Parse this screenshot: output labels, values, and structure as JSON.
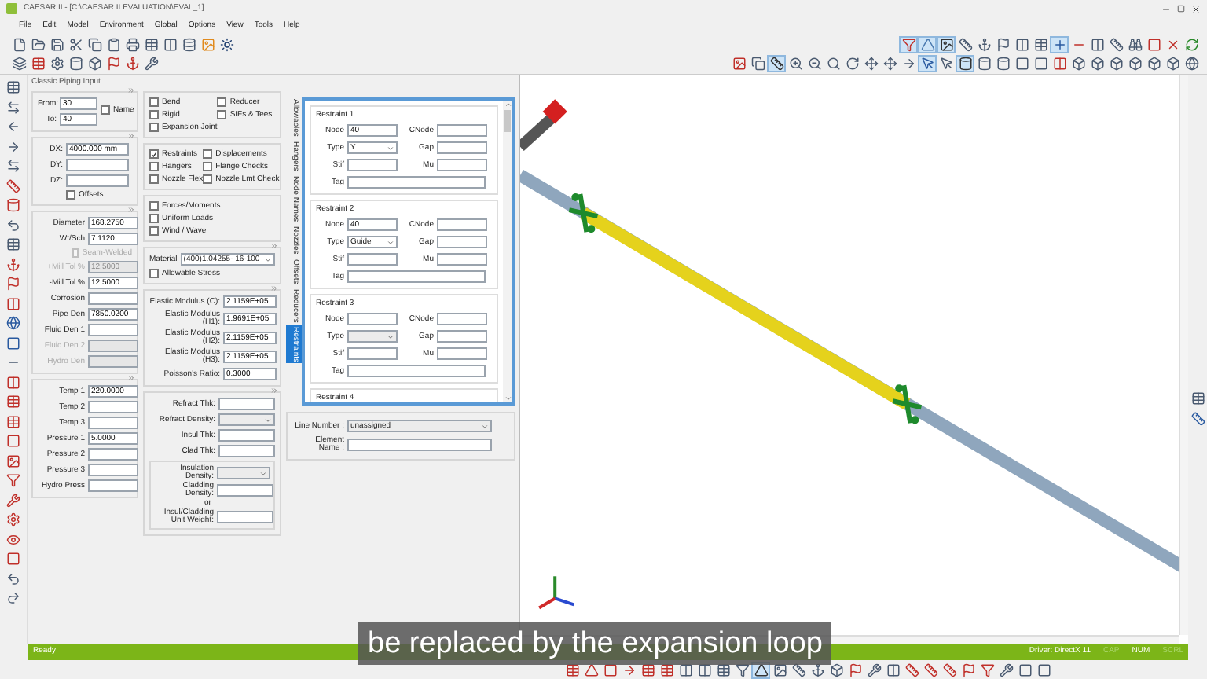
{
  "window": {
    "title": "CAESAR II - [C:\\CAESAR II EVALUATION\\EVAL_1]"
  },
  "menu": [
    "File",
    "Edit",
    "Model",
    "Environment",
    "Global",
    "Options",
    "View",
    "Tools",
    "Help"
  ],
  "panel_title": "Classic Piping Input",
  "node_fields": [
    {
      "label": "From:",
      "value": "30"
    },
    {
      "label": "To:",
      "value": "40"
    }
  ],
  "name_checkbox": {
    "label": "Name",
    "checked": false
  },
  "delta_fields": [
    {
      "label": "DX:",
      "value": "4000.000 mm"
    },
    {
      "label": "DY:"
    },
    {
      "label": "DZ:"
    }
  ],
  "offsets_checkbox": {
    "label": "Offsets",
    "checked": false
  },
  "pipe_fields": [
    {
      "kind": "input",
      "label": "Diameter",
      "value": "168.2750",
      "disabled": false
    },
    {
      "kind": "input",
      "label": "Wt/Sch",
      "value": "7.1120",
      "disabled": false
    },
    {
      "kind": "checkbox",
      "label": "Seam-Welded",
      "checked": false,
      "disabled": true
    },
    {
      "kind": "input",
      "label": "+Mill Tol %",
      "value": "12.5000",
      "disabled": true
    },
    {
      "kind": "input",
      "label": "-Mill Tol %",
      "value": "12.5000",
      "disabled": false
    },
    {
      "kind": "input",
      "label": "Corrosion",
      "disabled": false
    },
    {
      "kind": "input",
      "label": "Pipe Den",
      "value": "7850.0200",
      "disabled": false
    },
    {
      "kind": "input",
      "label": "Fluid Den 1",
      "disabled": false
    },
    {
      "kind": "input",
      "label": "Fluid Den 2",
      "disabled": true
    },
    {
      "kind": "input",
      "label": "Hydro Den",
      "disabled": true
    }
  ],
  "temp_fields": [
    {
      "label": "Temp 1",
      "value": "220.0000"
    },
    {
      "label": "Temp 2"
    },
    {
      "label": "Temp 3"
    },
    {
      "label": "Pressure 1",
      "value": "5.0000"
    },
    {
      "label": "Pressure 2"
    },
    {
      "label": "Pressure 3"
    },
    {
      "label": "Hydro Press"
    }
  ],
  "element_options": [
    [
      {
        "label": "Bend",
        "checked": false
      },
      {
        "label": "Reducer",
        "checked": false
      },
      {
        "label": "Rigid",
        "checked": false
      },
      {
        "label": "SIFs & Tees",
        "checked": false
      },
      {
        "label": "Expansion Joint",
        "checked": false
      }
    ],
    [
      {
        "label": "Restraints",
        "checked": true
      },
      {
        "label": "Displacements",
        "checked": false
      },
      {
        "label": "Hangers",
        "checked": false
      },
      {
        "label": "Flange Checks",
        "checked": false
      },
      {
        "label": "Nozzle Flex",
        "checked": false
      },
      {
        "label": "Nozzle Lmt Check",
        "checked": false
      }
    ],
    [
      {
        "label": "Forces/Moments",
        "checked": false
      },
      {
        "label": "Uniform Loads",
        "checked": false
      },
      {
        "label": "Wind / Wave",
        "checked": false
      }
    ]
  ],
  "material": {
    "label": "Material",
    "value": "(400)1.04255- 16-100"
  },
  "allowable_stress": {
    "label": "Allowable Stress",
    "checked": false
  },
  "modulus_fields": [
    {
      "label": "Elastic Modulus (C):",
      "value": "2.1159E+05"
    },
    {
      "label": "Elastic Modulus (H1):",
      "value": "1.9691E+05"
    },
    {
      "label": "Elastic Modulus (H2):",
      "value": "2.1159E+05"
    },
    {
      "label": "Elastic Modulus (H3):",
      "value": "2.1159E+05"
    },
    {
      "label": "Poisson's Ratio:",
      "value": "0.3000"
    }
  ],
  "refractory_fields": [
    {
      "kind": "input",
      "label": "Refract Thk:"
    },
    {
      "kind": "select",
      "label": "Refract Density:"
    },
    {
      "kind": "input",
      "label": "Insul Thk:"
    },
    {
      "kind": "input",
      "label": "Clad Thk:"
    }
  ],
  "insulation_fields": [
    {
      "kind": "select",
      "label": "Insulation Density:"
    },
    {
      "kind": "input",
      "label": "Cladding Density:"
    },
    {
      "kind": "note",
      "label": "or"
    },
    {
      "kind": "input",
      "label": "Insul/Cladding Unit Weight:"
    }
  ],
  "side_tabs": [
    {
      "label": "Allowables",
      "selected": false
    },
    {
      "label": "Hangers",
      "selected": false
    },
    {
      "label": "Node Names",
      "selected": false
    },
    {
      "label": "Nozzles",
      "selected": false
    },
    {
      "label": "Offsets",
      "selected": false
    },
    {
      "label": "Reducers",
      "selected": false
    },
    {
      "label": "Restraints",
      "selected": true
    }
  ],
  "restraints": [
    {
      "title": "Restraint 1",
      "fields": [
        {
          "kind": "input",
          "label": "Node",
          "value": "40"
        },
        {
          "kind": "input",
          "label": "CNode"
        },
        {
          "kind": "select",
          "label": "Type",
          "value": "Y"
        },
        {
          "kind": "input",
          "label": "Gap"
        },
        {
          "kind": "input",
          "label": "Stif"
        },
        {
          "kind": "input",
          "label": "Mu"
        },
        {
          "kind": "wide",
          "label": "Tag"
        }
      ]
    },
    {
      "title": "Restraint 2",
      "fields": [
        {
          "kind": "input",
          "label": "Node",
          "value": "40"
        },
        {
          "kind": "input",
          "label": "CNode"
        },
        {
          "kind": "select",
          "label": "Type",
          "value": "Guide"
        },
        {
          "kind": "input",
          "label": "Gap"
        },
        {
          "kind": "input",
          "label": "Stif"
        },
        {
          "kind": "input",
          "label": "Mu"
        },
        {
          "kind": "wide",
          "label": "Tag"
        }
      ]
    },
    {
      "title": "Restraint 3",
      "fields": [
        {
          "kind": "input",
          "label": "Node"
        },
        {
          "kind": "input",
          "label": "CNode"
        },
        {
          "kind": "select",
          "label": "Type"
        },
        {
          "kind": "input",
          "label": "Gap"
        },
        {
          "kind": "input",
          "label": "Stif"
        },
        {
          "kind": "input",
          "label": "Mu"
        },
        {
          "kind": "wide",
          "label": "Tag"
        }
      ]
    },
    {
      "title": "Restraint 4"
    }
  ],
  "line_number": {
    "label": "Line Number :",
    "value": "unassigned"
  },
  "element_name": {
    "label": "Element Name :"
  },
  "status_bar": {
    "message": "Ready",
    "indicators": [
      {
        "label": "Driver: DirectX 11",
        "on": true
      },
      {
        "label": "CAP",
        "on": false
      },
      {
        "label": "NUM",
        "on": true
      },
      {
        "label": "SCRL",
        "on": false
      }
    ]
  },
  "caption": "be replaced by the expansion loop"
}
